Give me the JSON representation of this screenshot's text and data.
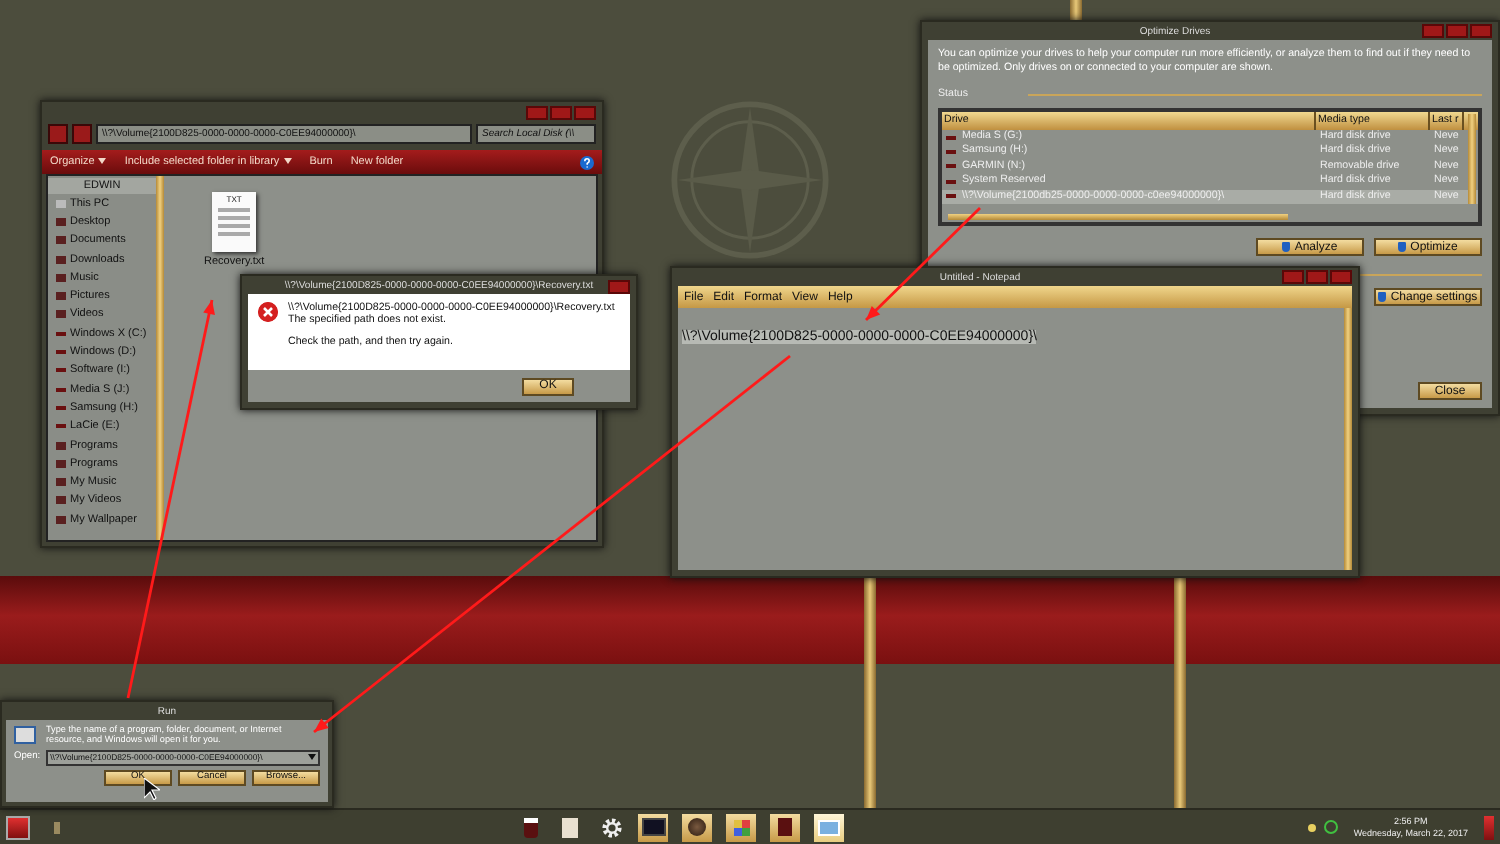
{
  "explorer": {
    "address": "\\\\?\\Volume{2100D825-0000-0000-0000-C0EE94000000}\\",
    "search_placeholder": "Search Local Disk (\\\\",
    "toolbar": [
      {
        "label": "Organize",
        "dropdown": true
      },
      {
        "label": "Include selected folder in library",
        "dropdown": true
      },
      {
        "label": "Burn",
        "dropdown": false
      },
      {
        "label": "New folder",
        "dropdown": false
      }
    ],
    "nav_header": "EDWIN",
    "nav_items": [
      {
        "label": "This PC",
        "kind": "pc"
      },
      {
        "label": "Desktop",
        "kind": "folder"
      },
      {
        "label": "Documents",
        "kind": "folder"
      },
      {
        "label": "Downloads",
        "kind": "folder"
      },
      {
        "label": "Music",
        "kind": "folder"
      },
      {
        "label": "Pictures",
        "kind": "folder"
      },
      {
        "label": "Videos",
        "kind": "folder"
      },
      {
        "label": "Windows X (C:)",
        "kind": "drive"
      },
      {
        "label": "Windows (D:)",
        "kind": "drive"
      },
      {
        "label": "Software (I:)",
        "kind": "drive"
      },
      {
        "label": "Media S (J:)",
        "kind": "drive"
      },
      {
        "label": "Samsung (H:)",
        "kind": "drive"
      },
      {
        "label": "LaCie (E:)",
        "kind": "drive"
      },
      {
        "label": "Programs",
        "kind": "folder"
      },
      {
        "label": "Programs",
        "kind": "folder"
      },
      {
        "label": "My Music",
        "kind": "folder"
      },
      {
        "label": "My Videos",
        "kind": "folder"
      },
      {
        "label": "My Wallpaper",
        "kind": "folder"
      }
    ],
    "file": {
      "icon_label": "TXT",
      "name": "Recovery.txt"
    }
  },
  "error_dialog": {
    "title": "\\\\?\\Volume{2100D825-0000-0000-0000-C0EE94000000}\\Recovery.txt",
    "path": "\\\\?\\Volume{2100D825-0000-0000-0000-C0EE94000000}\\Recovery.txt",
    "message": "The specified path does not exist.",
    "hint": "Check the path, and then try again.",
    "button": "OK"
  },
  "notepad": {
    "title": "Untitled - Notepad",
    "menu": [
      "File",
      "Edit",
      "Format",
      "View",
      "Help"
    ],
    "text": "\\\\?\\Volume{2100D825-0000-0000-0000-C0EE94000000}\\"
  },
  "optimize": {
    "title": "Optimize Drives",
    "description": "You can optimize your drives to help your computer run more efficiently, or analyze them to find out if they need to be optimized. Only drives on or connected to your computer are shown.",
    "status_label": "Status",
    "columns": [
      "Drive",
      "Media type",
      "Last r"
    ],
    "rows": [
      {
        "drive": "Media S (G:)",
        "media_type": "Hard disk drive",
        "last": "Neve",
        "selected": false
      },
      {
        "drive": "Samsung (H:)",
        "media_type": "Hard disk drive",
        "last": "Neve",
        "selected": false
      },
      {
        "drive": "GARMIN (N:)",
        "media_type": "Removable drive",
        "last": "Neve",
        "selected": false
      },
      {
        "drive": "System Reserved",
        "media_type": "Hard disk drive",
        "last": "Neve",
        "selected": false
      },
      {
        "drive": "\\\\?\\Volume{2100db25-0000-0000-0000-c0ee94000000}\\",
        "media_type": "Hard disk drive",
        "last": "Neve",
        "selected": true
      }
    ],
    "analyze": "Analyze",
    "optimize": "Optimize",
    "change_settings": "Change settings",
    "close": "Close"
  },
  "run": {
    "title": "Run",
    "description": "Type the name of a program, folder, document, or Internet resource, and Windows will open it for you.",
    "open_label": "Open:",
    "value": "\\\\?\\Volume{2100D825-0000-0000-0000-C0EE94000000}\\",
    "buttons": [
      "OK",
      "Cancel",
      "Browse..."
    ]
  },
  "taskbar": {
    "time": "2:56 PM",
    "date": "Wednesday, March 22, 2017"
  }
}
